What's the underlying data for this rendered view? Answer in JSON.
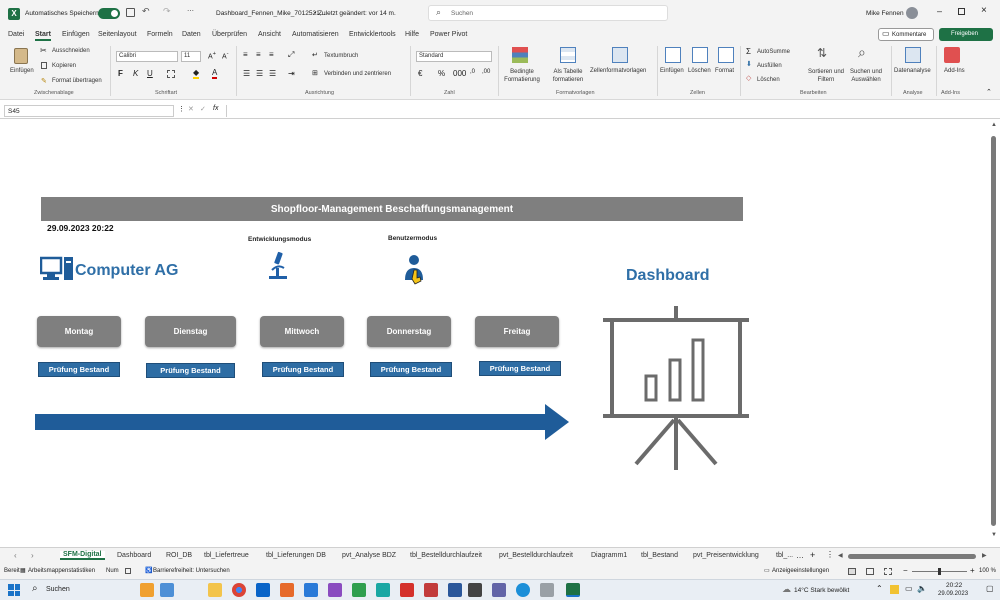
{
  "titlebar": {
    "autosave_label": "Automatisches Speichern",
    "filename": "Dashboard_Fennen_Mike_7012521,...",
    "saved_status": "• Zuletzt geändert: vor 14 m.",
    "search_placeholder": "Suchen",
    "user_name": "Mike Fennen"
  },
  "menu": {
    "items": [
      "Datei",
      "Start",
      "Einfügen",
      "Seitenlayout",
      "Formeln",
      "Daten",
      "Überprüfen",
      "Ansicht",
      "Automatisieren",
      "Entwicklertools",
      "Hilfe",
      "Power Pivot"
    ],
    "active": "Start",
    "comments_label": "Kommentare",
    "share_label": "Freigeben"
  },
  "ribbon": {
    "clipboard": {
      "paste": "Einfügen",
      "cut": "Ausschneiden",
      "copy": "Kopieren",
      "format_painter": "Format übertragen",
      "group": "Zwischenablage"
    },
    "font": {
      "name": "Calibri",
      "size": "11",
      "group": "Schriftart"
    },
    "alignment": {
      "wrap": "Textumbruch",
      "merge": "Verbinden und zentrieren",
      "group": "Ausrichtung"
    },
    "number": {
      "format": "Standard",
      "group": "Zahl"
    },
    "styles": {
      "conditional": "Bedingte Formatierung",
      "as_table": "Als Tabelle formatieren",
      "cell_styles": "Zellenformatvorlagen",
      "group": "Formatvorlagen"
    },
    "cells": {
      "insert": "Einfügen",
      "delete": "Löschen",
      "format": "Format",
      "group": "Zellen"
    },
    "editing": {
      "autosum": "AutoSumme",
      "fill": "Ausfüllen",
      "clear": "Löschen",
      "sort": "Sortieren und Filtern",
      "find": "Suchen und Auswählen",
      "group": "Bearbeiten"
    },
    "analysis": {
      "data_analysis": "Datenanalyse",
      "group": "Analyse"
    },
    "addins": {
      "addins": "Add-Ins",
      "group": "Add-Ins"
    }
  },
  "formula_bar": {
    "name_box": "S45",
    "fx": "fx",
    "value": ""
  },
  "dashboard": {
    "header": "Shopfloor-Management Beschaffungsmanagement",
    "timestamp": "29.09.2023 20:22",
    "dev_mode_label": "Entwicklungsmodus",
    "user_mode_label": "Benutzermodus",
    "company": "Computer AG",
    "dashboard_title": "Dashboard",
    "days": [
      "Montag",
      "Dienstag",
      "Mittwoch",
      "Donnerstag",
      "Freitag"
    ],
    "check_label": "Prüfung Bestand",
    "colors": {
      "header_bg": "#7f7f7f",
      "accent_blue": "#1f5c99",
      "button_blue": "#2e6da4",
      "title_blue": "#2f6fa7"
    }
  },
  "sheet_tabs": {
    "active": "SFM-Digital",
    "items": [
      "SFM-Digital",
      "Dashboard",
      "ROI_DB",
      "tbl_Liefertreue",
      "tbl_Lieferungen DB",
      "pvt_Analyse BDZ",
      "tbl_Bestelldurchlaufzeit",
      "pvt_Bestelldurchlaufzeit",
      "Diagramm1",
      "tbl_Bestand",
      "pvt_Preisentwicklung",
      "tbl_..."
    ]
  },
  "status": {
    "ready": "Bereit",
    "workbook_stats": "Arbeitsmappenstatistiken",
    "num": "Num",
    "accessibility": "Barrierefreiheit: Untersuchen",
    "display_settings": "Anzeigeeinstellungen",
    "zoom": "100 %"
  },
  "taskbar": {
    "search_placeholder": "Suchen",
    "weather": "14°C  Stark bewölkt",
    "time": "20:22",
    "date": "29.09.2023"
  }
}
